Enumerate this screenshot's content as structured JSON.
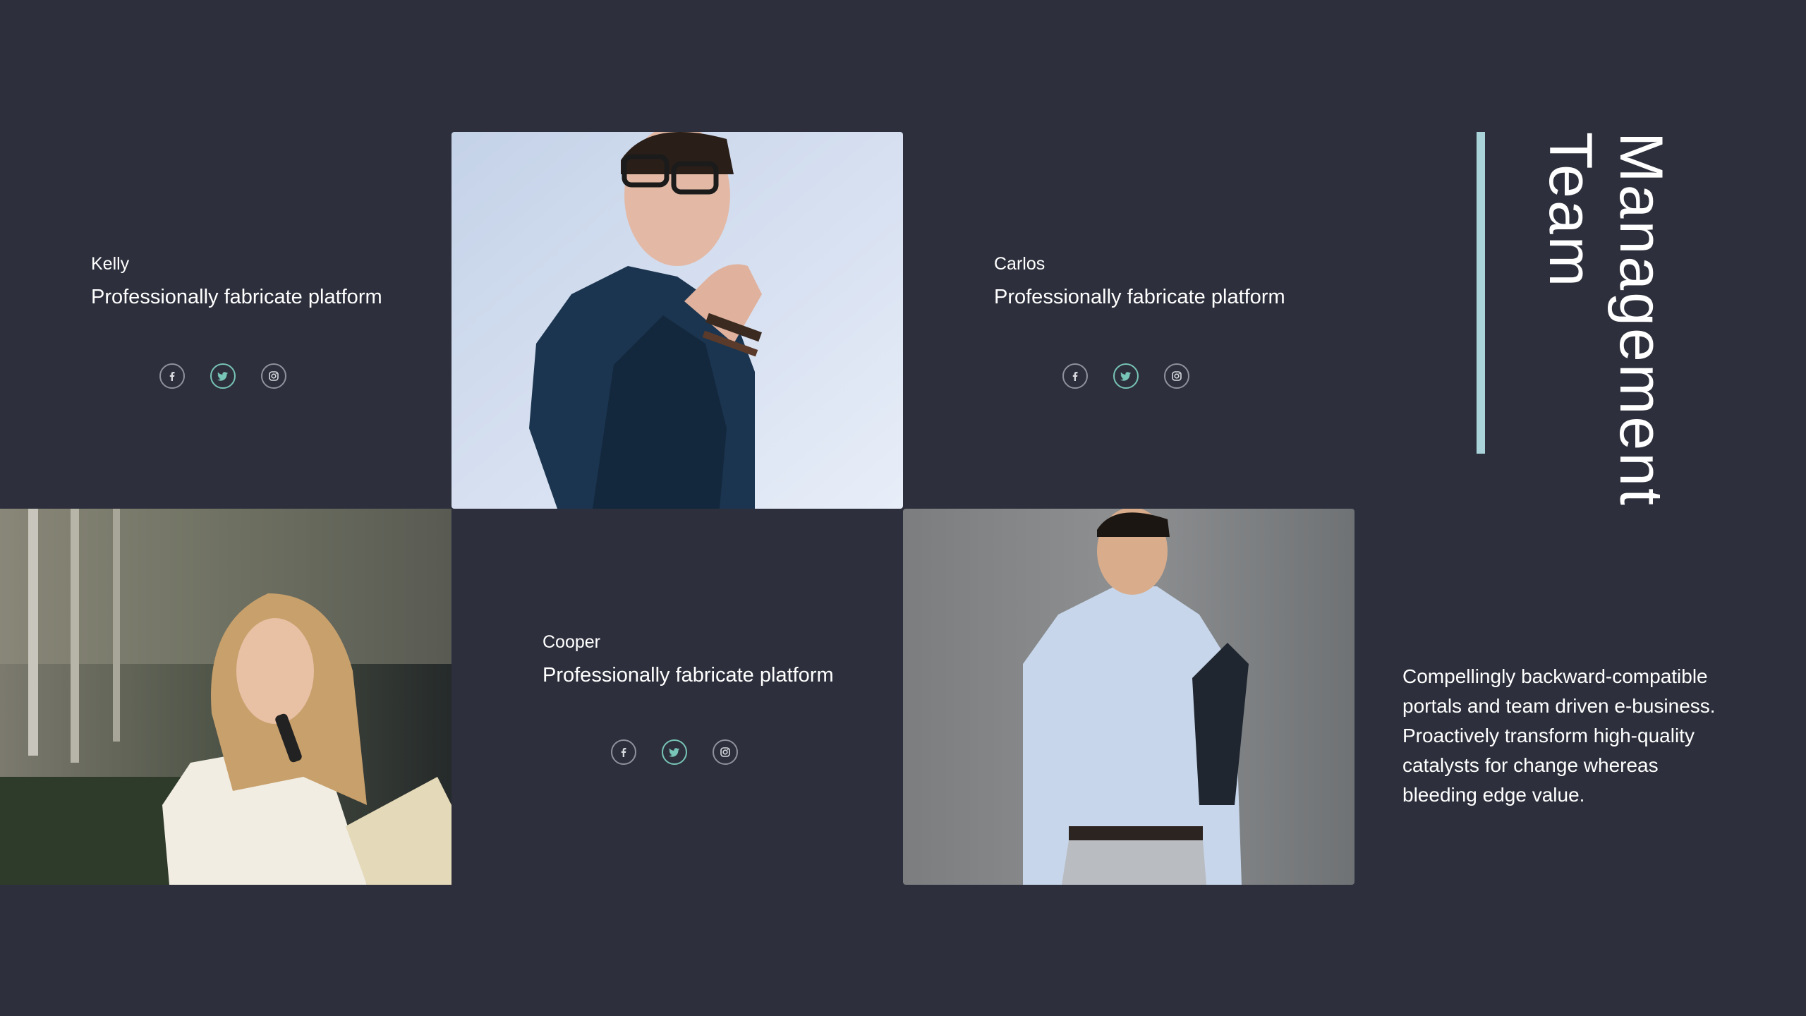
{
  "title": {
    "line1": "Management",
    "line2": "Team"
  },
  "members": [
    {
      "name": "Kelly",
      "role": "Professionally fabricate platform"
    },
    {
      "name": "Carlos",
      "role": "Professionally fabricate platform"
    },
    {
      "name": "Cooper",
      "role": "Professionally fabricate platform"
    }
  ],
  "socials": [
    "facebook-icon",
    "twitter-icon",
    "instagram-icon"
  ],
  "description": "Compellingly backward-compatible portals and team driven e-business.  Proactively transform high-quality catalysts for change whereas bleeding edge value.",
  "colors": {
    "background": "#2d303c",
    "accent": "#a9d3d8",
    "twitter_ring": "#78c4b6"
  }
}
